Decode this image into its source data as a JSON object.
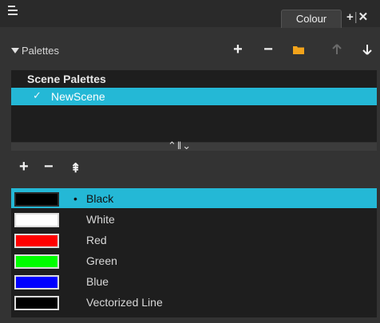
{
  "window": {
    "tab_label": "Colour",
    "add_tab_glyph": "+",
    "close_tab_glyph": "✕"
  },
  "palettes": {
    "title": "Palettes",
    "toolbar": {
      "add": "+",
      "remove": "−",
      "folder_icon": "folder-icon",
      "move_up_icon": "arrow-up-icon",
      "move_down_icon": "arrow-down-icon"
    },
    "group_label": "Scene Palettes",
    "items": [
      {
        "name": "NewScene",
        "selected": true
      }
    ]
  },
  "splitter": {
    "label": "⌃‖⌄"
  },
  "colours": {
    "toolbar": {
      "add": "+",
      "remove": "−",
      "texture": "⇞"
    },
    "items": [
      {
        "name": "Black",
        "swatch": "#000000",
        "selected": true
      },
      {
        "name": "White",
        "swatch": "#ffffff",
        "selected": false
      },
      {
        "name": "Red",
        "swatch": "#ff0000",
        "selected": false
      },
      {
        "name": "Green",
        "swatch": "#00ff00",
        "selected": false
      },
      {
        "name": "Blue",
        "swatch": "#0000ff",
        "selected": false
      },
      {
        "name": "Vectorized Line",
        "swatch": "#000000",
        "selected": false
      }
    ]
  },
  "colors": {
    "selection": "#24b8d6",
    "background": "#333333",
    "list_background": "#1e1e1e"
  }
}
